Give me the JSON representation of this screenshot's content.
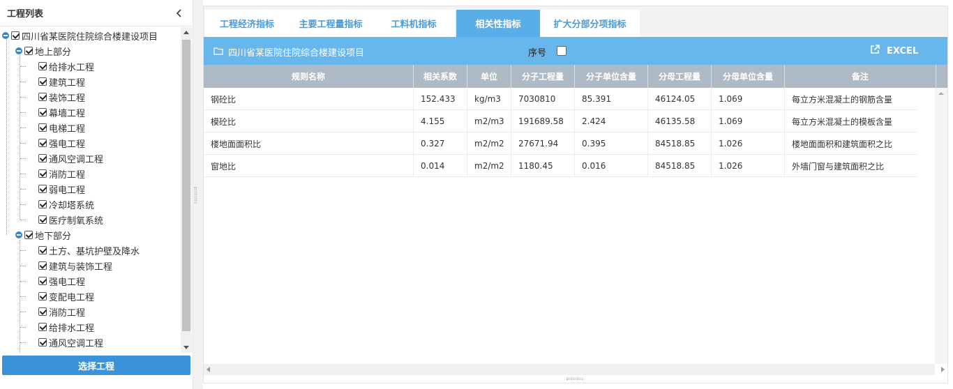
{
  "sidebar": {
    "title": "工程列表",
    "root": "四川省某医院住院综合楼建设项目",
    "groups": [
      {
        "label": "地上部分",
        "items": [
          "给排水工程",
          "建筑工程",
          "装饰工程",
          "幕墙工程",
          "电梯工程",
          "强电工程",
          "通风空调工程",
          "消防工程",
          "弱电工程",
          "冷却塔系统",
          "医疗制氧系统"
        ]
      },
      {
        "label": "地下部分",
        "items": [
          "土方、基坑护壁及降水",
          "建筑与装饰工程",
          "强电工程",
          "变配电工程",
          "消防工程",
          "给排水工程",
          "通风空调工程"
        ]
      }
    ],
    "select_button": "选择工程"
  },
  "tabs": [
    {
      "label": "工程经济指标",
      "active": false
    },
    {
      "label": "主要工程量指标",
      "active": false
    },
    {
      "label": "工料机指标",
      "active": false
    },
    {
      "label": "相关性指标",
      "active": true
    },
    {
      "label": "扩大分部分项指标",
      "active": false
    }
  ],
  "project_bar": {
    "project_name": "四川省某医院住院综合楼建设项目",
    "seq_label": "序号",
    "excel_label": "EXCEL"
  },
  "table": {
    "headers": [
      "规则名称",
      "相关系数",
      "单位",
      "分子工程量",
      "分子单位含量",
      "分母工程量",
      "分母单位含量",
      "备注"
    ],
    "rows": [
      [
        "钢砼比",
        "152.433",
        "kg/m3",
        "7030810",
        "85.391",
        "46124.05",
        "1.069",
        "每立方米混凝土的钢筋含量"
      ],
      [
        "模砼比",
        "4.155",
        "m2/m3",
        "191689.58",
        "2.424",
        "46135.58",
        "1.069",
        "每立方米混凝土的模板含量"
      ],
      [
        "楼地面面积比",
        "0.327",
        "m2/m2",
        "27671.94",
        "0.395",
        "84518.85",
        "1.026",
        "楼地面面积和建筑面积之比"
      ],
      [
        "窗地比",
        "0.014",
        "m2/m2",
        "1180.45",
        "0.016",
        "84518.85",
        "1.026",
        "外墙门窗与建筑面积之比"
      ]
    ]
  },
  "colors": {
    "tab_text": "#4a9bd6",
    "tab_active_bg": "#5aaee8",
    "project_bar_bg": "#67b6ec",
    "table_header_bg": "#aebbc6",
    "select_button_bg": "#3a93d9",
    "tree_toggle": "#3a87c8"
  }
}
